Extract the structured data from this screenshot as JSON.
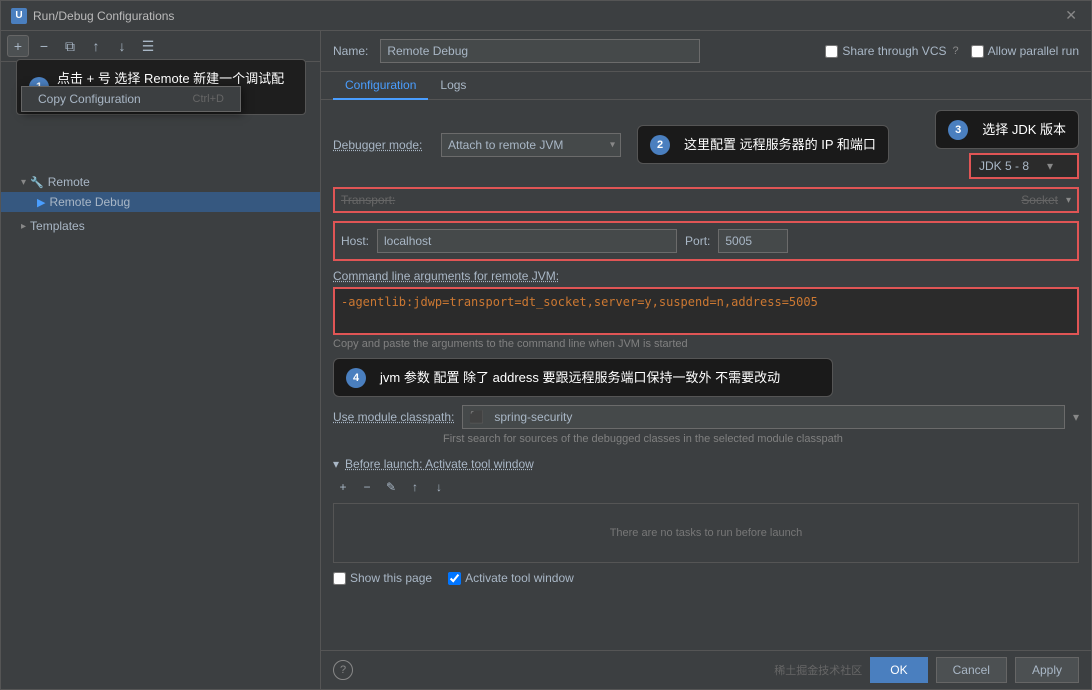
{
  "dialog": {
    "title": "Run/Debug Configurations",
    "title_icon": "U"
  },
  "sidebar": {
    "add_btn": "+",
    "remove_btn": "−",
    "copy_btn": "⧉",
    "up_btn": "↑",
    "down_btn": "↓",
    "filter_btn": "☰",
    "items": [
      {
        "label": "Remote",
        "expanded": true,
        "indent": 0
      },
      {
        "label": "Remote Debug",
        "indent": 1,
        "selected": true
      }
    ],
    "templates_label": "Templates",
    "context_menu": {
      "copy_item": "Copy Configuration",
      "copy_shortcut": "Ctrl+D"
    }
  },
  "annotations": {
    "ann1": {
      "badge": "1",
      "text": "点击 + 号 选择  Remote 新建一个调试配置"
    },
    "ann2": {
      "badge": "2",
      "text": "这里配置 远程服务器的 IP 和端口"
    },
    "ann3": {
      "badge": "3",
      "text": "选择 JDK 版本"
    },
    "ann4": {
      "badge": "4",
      "text": "jvm 参数 配置 除了 address 要跟远程服务端口保持一致外 不需要改动"
    }
  },
  "header": {
    "name_label": "Name:",
    "name_value": "Remote Debug",
    "share_label": "Share through VCS",
    "allow_parallel_label": "Allow parallel run"
  },
  "tabs": {
    "configuration_label": "Configuration",
    "logs_label": "Logs"
  },
  "config": {
    "debugger_mode_label": "Debugger mode:",
    "debugger_mode_value": "Attach to remote JVM",
    "transport_label": "Transport:",
    "transport_value": "Socket",
    "host_label": "Host:",
    "host_value": "localhost",
    "port_label": "Port:",
    "port_value": "5005",
    "cmd_label": "Command line arguments for remote JVM:",
    "cmd_value": "-agentlib:jdwp=transport=dt_socket,server=y,suspend=n,address=5005",
    "cmd_hint": "Copy and paste the arguments to the command line when JVM is started",
    "module_label": "Use module classpath:",
    "module_value": "spring-security",
    "module_hint": "First search for sources of the debugged classes in the selected module classpath",
    "before_launch_label": "Before launch: Activate tool window",
    "no_tasks_text": "There are no tasks to run before launch",
    "show_page_label": "Show this page",
    "activate_tool_label": "Activate tool window",
    "jdk_value": "JDK 5 - 8"
  },
  "footer": {
    "ok_label": "OK",
    "cancel_label": "Cancel",
    "apply_label": "Apply"
  },
  "watermark": "稀土掘金技术社区"
}
